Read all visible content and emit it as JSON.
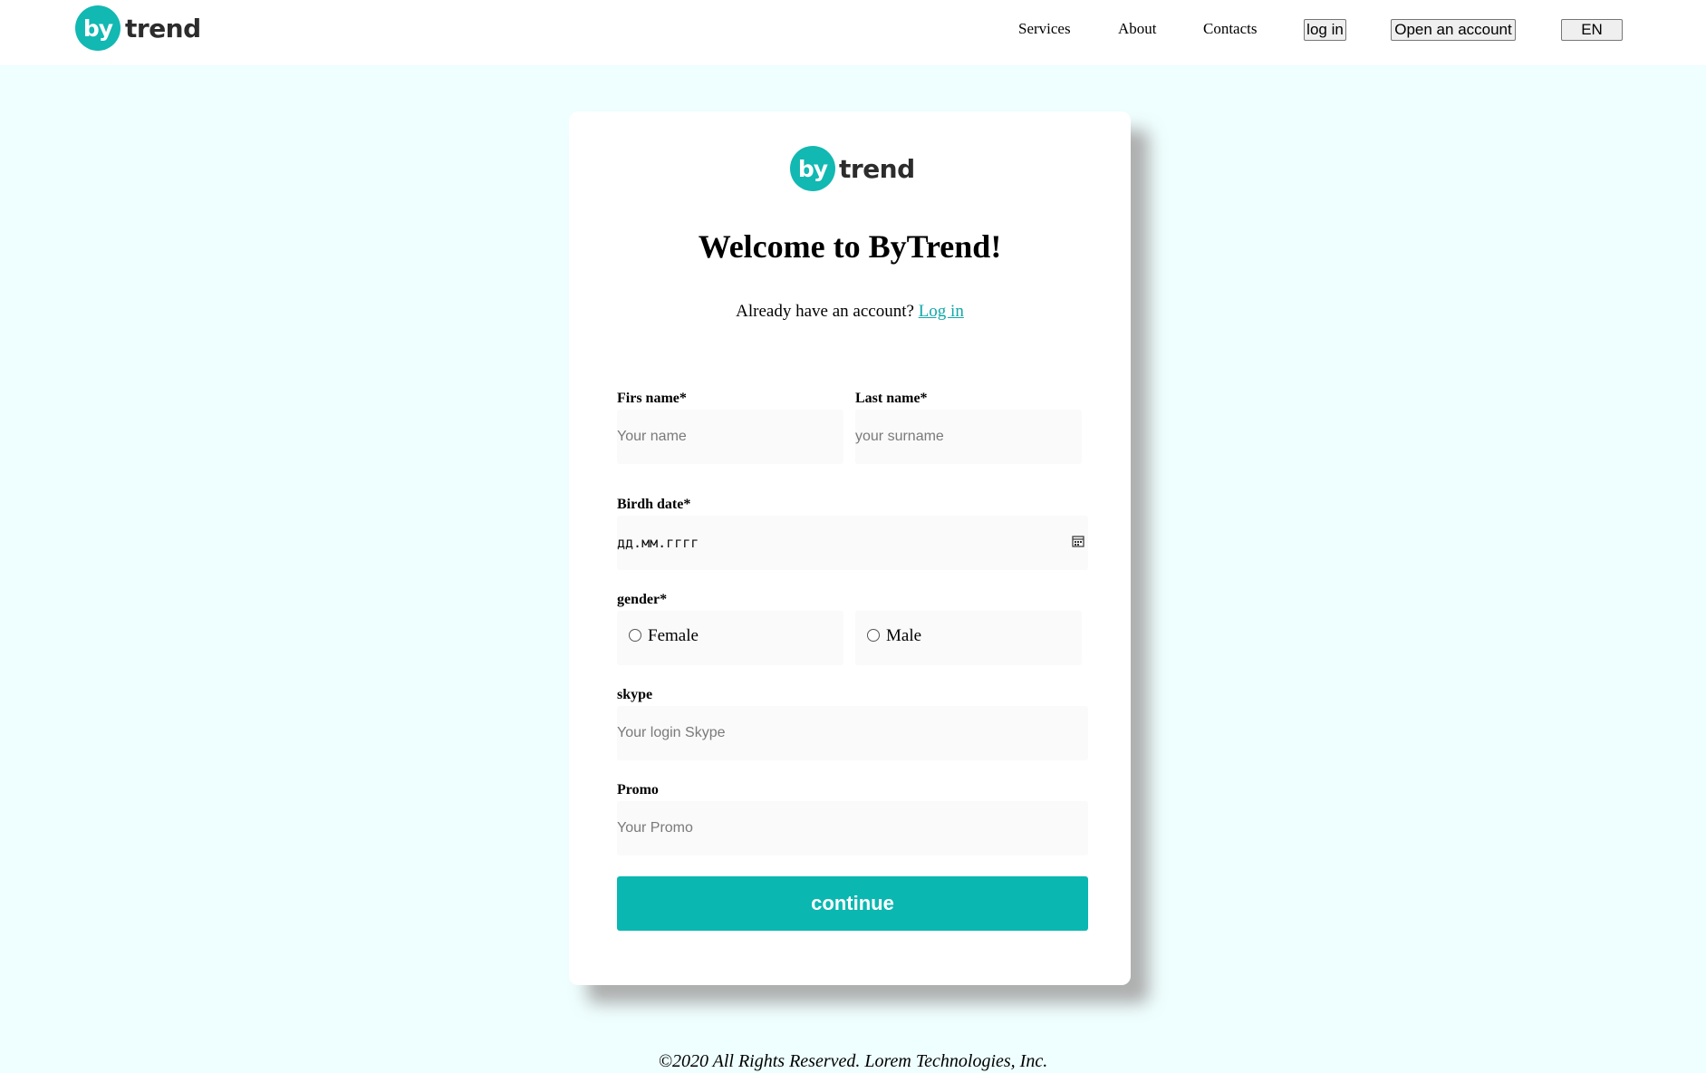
{
  "header": {
    "logo": {
      "mark": "by",
      "word": "trend"
    },
    "nav": {
      "services": "Services",
      "about": "About",
      "contacts": "Contacts"
    },
    "buttons": {
      "login": "log in",
      "open_account": "Open an account",
      "language": "EN"
    }
  },
  "card": {
    "logo": {
      "mark": "by",
      "word": "trend"
    },
    "title": "Welcome to ByTrend!",
    "already_text": "Already have an account?",
    "login_link": "Log in",
    "form": {
      "first_name": {
        "label": "Firs name*",
        "placeholder": "Your name"
      },
      "last_name": {
        "label": "Last name*",
        "placeholder": "your surname"
      },
      "birth_date": {
        "label": "Birdh date*",
        "placeholder": "дд.мм.гггг",
        "icon": "calendar-icon"
      },
      "gender": {
        "label": "gender*",
        "options": [
          "Female",
          "Male"
        ]
      },
      "skype": {
        "label": "skype",
        "placeholder": "Your login Skype"
      },
      "promo": {
        "label": "Promo",
        "placeholder": "Your Promo"
      },
      "submit": "continue"
    }
  },
  "footer": {
    "copyright": "©2020 All Rights Reserved. Lorem Technologies, Inc."
  },
  "colors": {
    "accent": "#0ab7b1",
    "page_background": "#effefe",
    "link": "#12a8a8"
  }
}
